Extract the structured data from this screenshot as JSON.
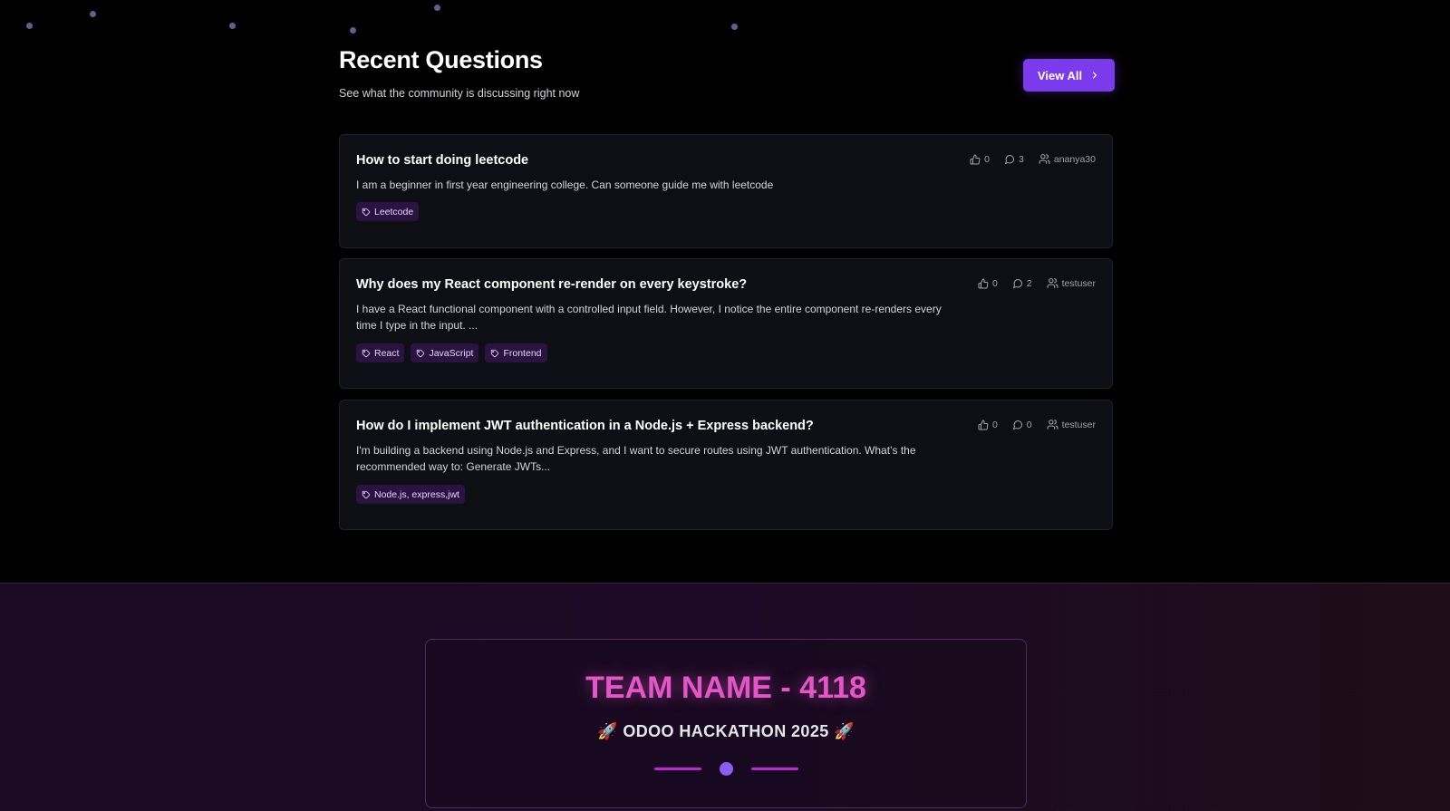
{
  "section": {
    "title": "Recent Questions",
    "subtitle": "See what the community is discussing right now",
    "view_all_label": "View All"
  },
  "questions": [
    {
      "title": "How to start doing leetcode",
      "body": "I am a beginner in first year engineering college. Can someone guide me with leetcode",
      "tags": [
        "Leetcode"
      ],
      "votes": "0",
      "answers": "3",
      "author": "ananya30"
    },
    {
      "title": "Why does my React component re-render on every keystroke?",
      "body": "I have a React functional component with a controlled input field. However, I notice the entire component re-renders every time I type in the input. ...",
      "tags": [
        "React",
        "JavaScript",
        "Frontend"
      ],
      "votes": "0",
      "answers": "2",
      "author": "testuser"
    },
    {
      "title": "How do I implement JWT authentication in a Node.js + Express backend?",
      "body": "I'm building a backend using Node.js and Express, and I want to secure routes using JWT authentication. What’s the recommended way to: Generate JWTs...",
      "tags": [
        "Node.js, express,jwt"
      ],
      "votes": "0",
      "answers": "0",
      "author": "testuser"
    }
  ],
  "footer": {
    "team_name": "TEAM NAME - 4118",
    "event": "🚀 ODOO HACKATHON 2025 🚀"
  },
  "colors": {
    "accent": "#7c3aed",
    "tag_bg": "#2a1340",
    "team_name": "#e455c8"
  },
  "icons": [
    "thumbs-up-icon",
    "comment-icon",
    "users-icon",
    "tag-icon",
    "chevron-right-icon"
  ]
}
